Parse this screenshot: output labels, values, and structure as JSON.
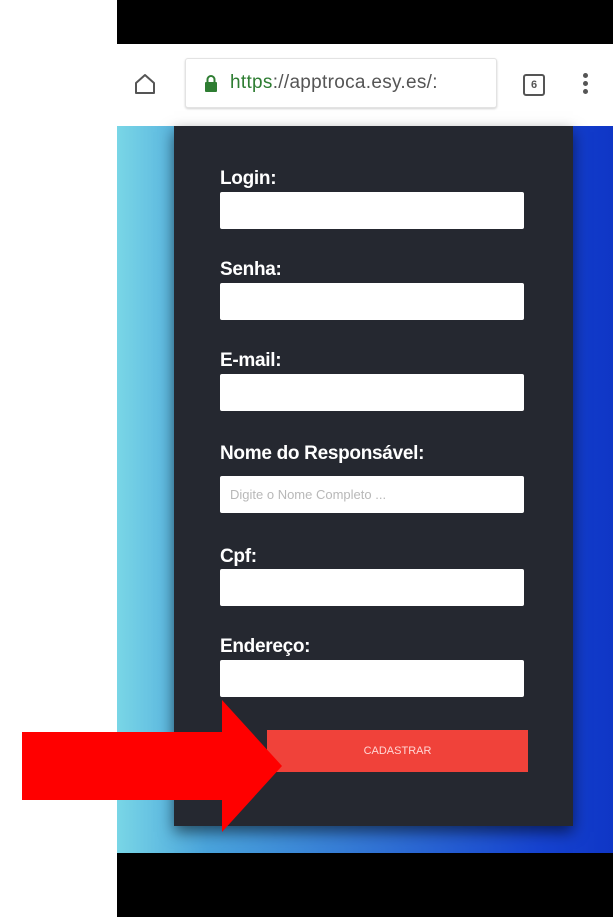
{
  "browser": {
    "url_scheme": "https",
    "url_rest": "://apptroca.esy.es/:",
    "tab_count": "6"
  },
  "form": {
    "fields": [
      {
        "label": "Login:",
        "value": "",
        "placeholder": ""
      },
      {
        "label": "Senha:",
        "value": "",
        "placeholder": ""
      },
      {
        "label": "E-mail:",
        "value": "",
        "placeholder": ""
      },
      {
        "label": "Nome do Responsável:",
        "value": "",
        "placeholder": "Digite o Nome Completo ..."
      },
      {
        "label": "Cpf:",
        "value": "",
        "placeholder": ""
      },
      {
        "label": "Endereço:",
        "value": "",
        "placeholder": ""
      }
    ],
    "submit_label": "Cadastrar"
  },
  "colors": {
    "card": "#252830",
    "submit": "#f0423a",
    "annotation_arrow": "#ff0000"
  }
}
